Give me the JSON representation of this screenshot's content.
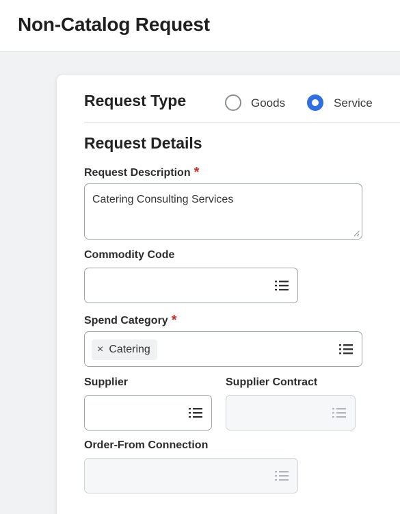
{
  "header": {
    "title": "Non-Catalog Request"
  },
  "request_type": {
    "title": "Request Type",
    "options": [
      {
        "label": "Goods",
        "selected": false
      },
      {
        "label": "Service",
        "selected": true
      }
    ]
  },
  "request_details": {
    "title": "Request Details",
    "description": {
      "label": "Request Description",
      "required": "*",
      "value": "Catering Consulting Services"
    },
    "commodity_code": {
      "label": "Commodity Code",
      "value": ""
    },
    "spend_category": {
      "label": "Spend Category",
      "required": "*",
      "chip_remove": "×",
      "selected_chip": "Catering"
    },
    "supplier": {
      "label": "Supplier",
      "value": ""
    },
    "supplier_contract": {
      "label": "Supplier Contract",
      "value": "",
      "disabled": true
    },
    "order_from_connection": {
      "label": "Order-From Connection",
      "value": "",
      "disabled": true
    }
  },
  "colors": {
    "accent": "#2f6fe0",
    "required": "#c9322b",
    "border": "#9ea3a8",
    "disabled_border": "#d0d3d6"
  },
  "icons": {
    "prompt": "list-icon"
  }
}
